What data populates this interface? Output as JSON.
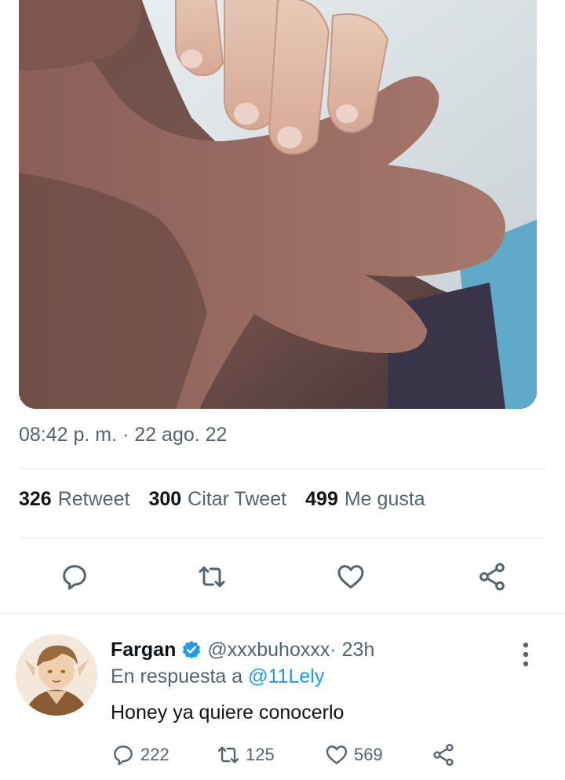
{
  "tweet": {
    "image_alt": "Foto: mano de bebé sosteniendo el dedo de un adulto",
    "timestamp": "08:42 p. m. · 22 ago. 22",
    "stats": [
      {
        "count": "326",
        "label": "Retweet"
      },
      {
        "count": "300",
        "label": "Citar Tweet"
      },
      {
        "count": "499",
        "label": "Me gusta"
      }
    ],
    "actions": [
      "reply-icon",
      "retweet-icon",
      "like-icon",
      "share-icon"
    ]
  },
  "reply": {
    "name": "Fargan",
    "handle": "@xxxbuhoxxx",
    "time": " · 23h",
    "reply_prefix": "En respuesta a ",
    "reply_to": "@11Lely",
    "text": "Honey ya quiere conocerlo",
    "counts": {
      "replies": "222",
      "retweets": "125",
      "likes": "569"
    }
  },
  "colors": {
    "accent": "#1d9bf0",
    "muted": "#536471",
    "text": "#0f1419"
  }
}
